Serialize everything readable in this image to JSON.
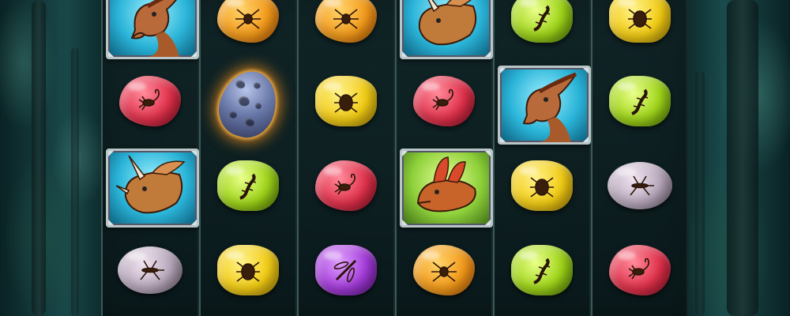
{
  "game": {
    "theme": "jurassic slot",
    "reels": [
      {
        "symbols": [
          "parasaurolophus",
          "amber-red-scorpion",
          "triceratops",
          "amber-grey-mosquito"
        ]
      },
      {
        "symbols": [
          "amber-orange-spider",
          "meteor-egg",
          "amber-green-lizard",
          "amber-yellow-beetle"
        ]
      },
      {
        "symbols": [
          "amber-orange-spider",
          "amber-yellow-beetle",
          "amber-red-scorpion",
          "amber-purple-dragonfly"
        ]
      },
      {
        "symbols": [
          "triceratops",
          "amber-red-scorpion",
          "dilophosaurus",
          "amber-orange-spider"
        ]
      },
      {
        "symbols": [
          "amber-green-lizard",
          "parasaurolophus",
          "amber-yellow-beetle",
          "amber-green-lizard"
        ]
      },
      {
        "symbols": [
          "amber-yellow-beetle",
          "amber-green-lizard",
          "amber-grey-mosquito",
          "amber-red-scorpion"
        ]
      }
    ]
  },
  "colors": {
    "background": "#0d2a2c",
    "reel_border": "#3a5a5a",
    "tile_frame": "#b9c6c8"
  }
}
